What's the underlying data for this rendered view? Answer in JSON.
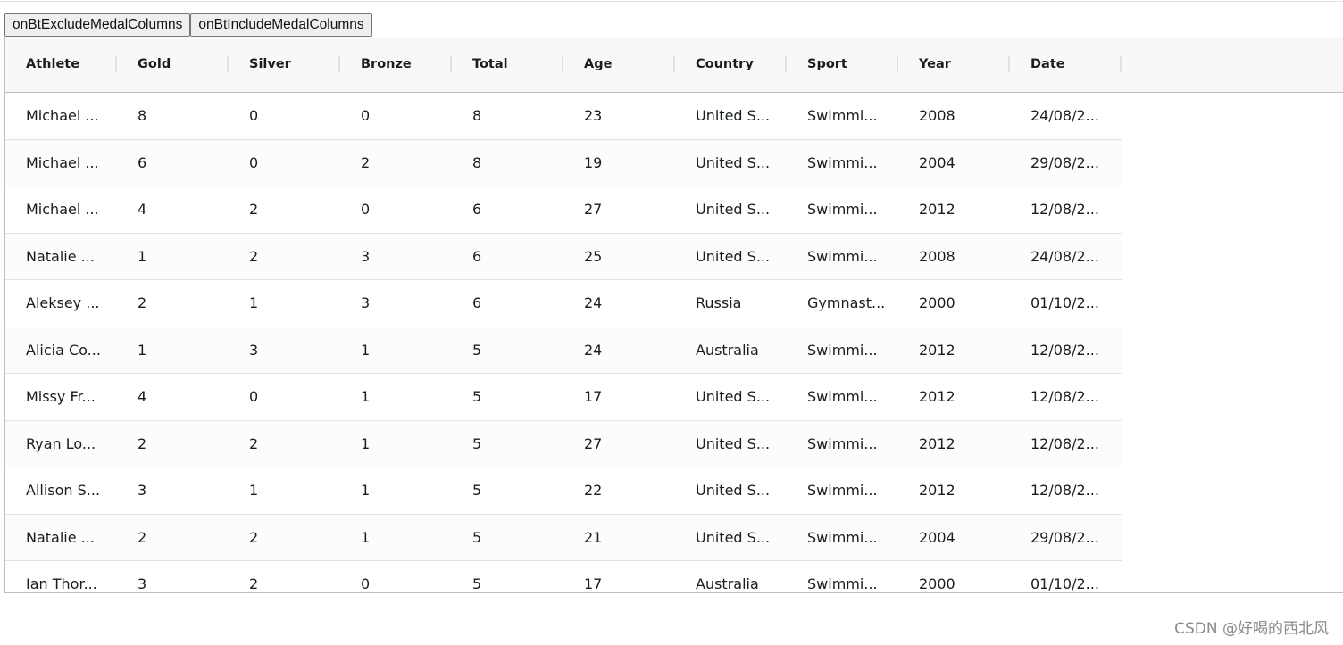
{
  "toolbar": {
    "exclude_label": "onBtExcludeMedalColumns",
    "include_label": "onBtIncludeMedalColumns"
  },
  "grid": {
    "columns": [
      "Athlete",
      "Gold",
      "Silver",
      "Bronze",
      "Total",
      "Age",
      "Country",
      "Sport",
      "Year",
      "Date"
    ],
    "rows": [
      [
        "Michael ...",
        "8",
        "0",
        "0",
        "8",
        "23",
        "United S...",
        "Swimmi...",
        "2008",
        "24/08/2..."
      ],
      [
        "Michael ...",
        "6",
        "0",
        "2",
        "8",
        "19",
        "United S...",
        "Swimmi...",
        "2004",
        "29/08/2..."
      ],
      [
        "Michael ...",
        "4",
        "2",
        "0",
        "6",
        "27",
        "United S...",
        "Swimmi...",
        "2012",
        "12/08/2..."
      ],
      [
        "Natalie ...",
        "1",
        "2",
        "3",
        "6",
        "25",
        "United S...",
        "Swimmi...",
        "2008",
        "24/08/2..."
      ],
      [
        "Aleksey ...",
        "2",
        "1",
        "3",
        "6",
        "24",
        "Russia",
        "Gymnast...",
        "2000",
        "01/10/2..."
      ],
      [
        "Alicia Co...",
        "1",
        "3",
        "1",
        "5",
        "24",
        "Australia",
        "Swimmi...",
        "2012",
        "12/08/2..."
      ],
      [
        "Missy Fr...",
        "4",
        "0",
        "1",
        "5",
        "17",
        "United S...",
        "Swimmi...",
        "2012",
        "12/08/2..."
      ],
      [
        "Ryan Lo...",
        "2",
        "2",
        "1",
        "5",
        "27",
        "United S...",
        "Swimmi...",
        "2012",
        "12/08/2..."
      ],
      [
        "Allison S...",
        "3",
        "1",
        "1",
        "5",
        "22",
        "United S...",
        "Swimmi...",
        "2012",
        "12/08/2..."
      ],
      [
        "Natalie ...",
        "2",
        "2",
        "1",
        "5",
        "21",
        "United S...",
        "Swimmi...",
        "2004",
        "29/08/2..."
      ],
      [
        "Ian Thor...",
        "3",
        "2",
        "0",
        "5",
        "17",
        "Australia",
        "Swimmi...",
        "2000",
        "01/10/2..."
      ]
    ]
  },
  "watermark": "CSDN @好喝的西北风"
}
